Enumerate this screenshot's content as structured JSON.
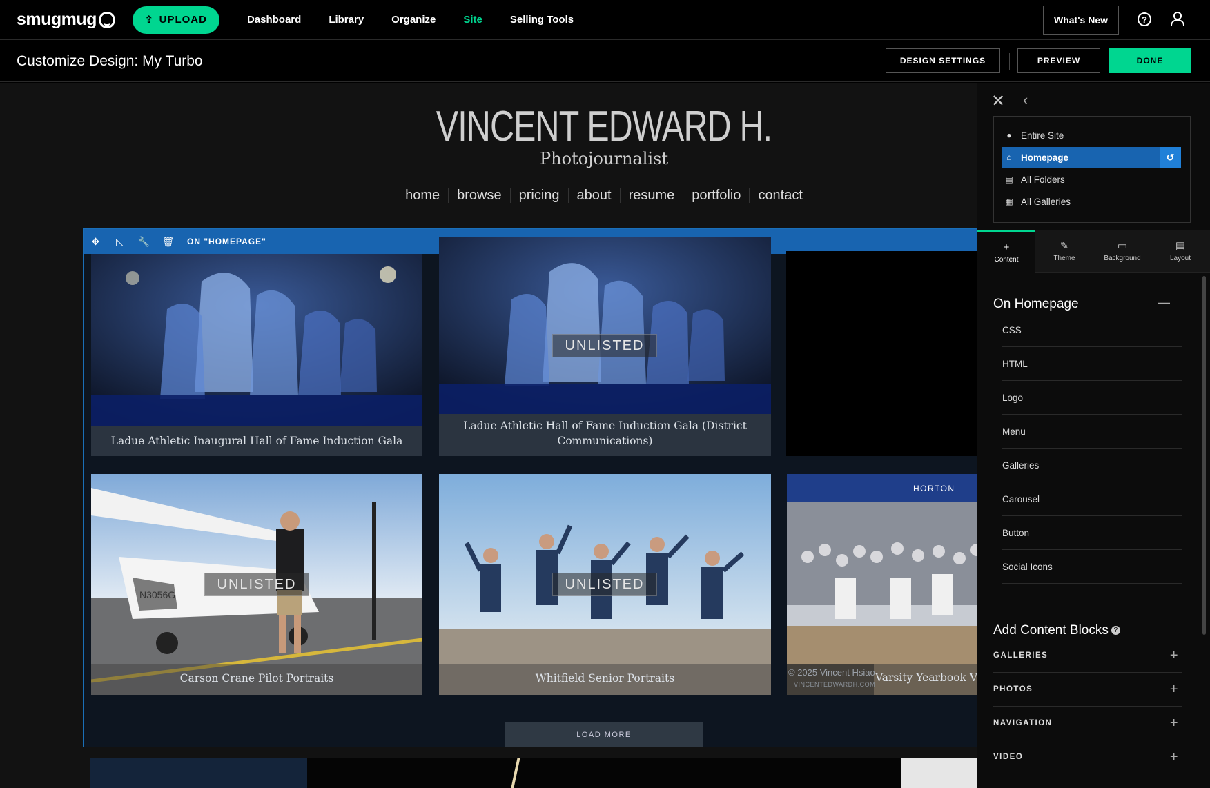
{
  "topnav": {
    "logo": "smugmug",
    "upload_label": "UPLOAD",
    "items": [
      "Dashboard",
      "Library",
      "Organize",
      "Site",
      "Selling Tools"
    ],
    "active_item": "Site",
    "whats_new": "What's New",
    "help_symbol": "?"
  },
  "subbar": {
    "title": "Customize Design: My Turbo",
    "design_settings": "DESIGN SETTINGS",
    "preview": "PREVIEW",
    "done": "DONE"
  },
  "site": {
    "title": "VINCENT EDWARD H.",
    "subtitle": "Photojournalist",
    "menu": [
      "home",
      "browse",
      "pricing",
      "about",
      "resume",
      "portfolio",
      "contact"
    ]
  },
  "block": {
    "label": "ON \"HOMEPAGE\"",
    "load_more": "LOAD MORE",
    "unlisted_label": "UNLISTED",
    "galleries": [
      {
        "caption": "Ladue Athletic Inaugural Hall of Fame Induction Gala",
        "unlisted": false
      },
      {
        "caption": "Ladue Athletic Hall of Fame Induction Gala (District Communications)",
        "unlisted": true
      },
      {
        "caption": "",
        "unlisted": false
      },
      {
        "caption": "Carson Crane Pilot Portraits",
        "unlisted": true
      },
      {
        "caption": "Whitfield Senior Portraits",
        "unlisted": true
      },
      {
        "caption": "Varsity Yearbook V",
        "unlisted": false,
        "watermark": "© 2025 Vincent Hsiao",
        "watermark_url": "VINCENTEDWARDH.COM",
        "sign": "HORTON"
      }
    ]
  },
  "panel": {
    "scope": [
      {
        "label": "Entire Site",
        "icon": "globe-icon"
      },
      {
        "label": "Homepage",
        "icon": "home-icon"
      },
      {
        "label": "All Folders",
        "icon": "folder-icon"
      },
      {
        "label": "All Galleries",
        "icon": "gallery-icon"
      }
    ],
    "tabs": [
      "Content",
      "Theme",
      "Background",
      "Layout"
    ],
    "section_title": "On Homepage",
    "items": [
      "CSS",
      "HTML",
      "Logo",
      "Menu",
      "Galleries",
      "Carousel",
      "Button",
      "Social Icons"
    ],
    "add_title": "Add Content Blocks",
    "add_items": [
      "GALLERIES",
      "PHOTOS",
      "NAVIGATION",
      "VIDEO"
    ]
  },
  "colors": {
    "accent": "#00d690",
    "selection": "#1864b0"
  }
}
